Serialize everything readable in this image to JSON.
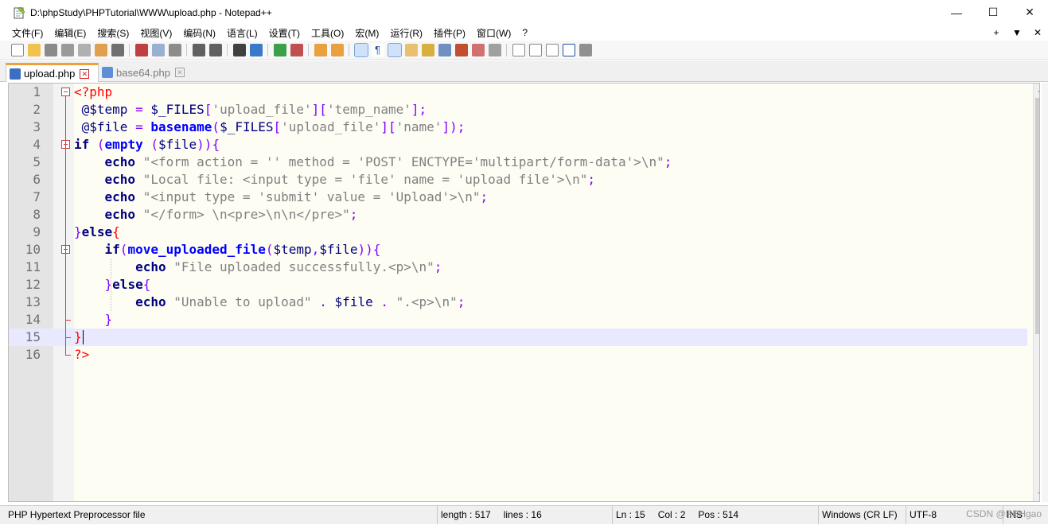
{
  "window": {
    "title": "D:\\phpStudy\\PHPTutorial\\WWW\\upload.php - Notepad++",
    "minimize": "—",
    "maximize": "☐",
    "close": "✕"
  },
  "menu": {
    "items": [
      "文件(F)",
      "编辑(E)",
      "搜索(S)",
      "视图(V)",
      "编码(N)",
      "语言(L)",
      "设置(T)",
      "工具(O)",
      "宏(M)",
      "运行(R)",
      "插件(P)",
      "窗口(W)",
      "?"
    ],
    "right_plus": "+",
    "right_down": "▼",
    "right_close": "✕"
  },
  "tabs": [
    {
      "label": "upload.php",
      "active": true
    },
    {
      "label": "base64.php",
      "active": false
    }
  ],
  "tab_close_glyph": "✕",
  "editor": {
    "line_numbers": [
      "1",
      "2",
      "3",
      "4",
      "5",
      "6",
      "7",
      "8",
      "9",
      "10",
      "11",
      "12",
      "13",
      "14",
      "15",
      "16"
    ],
    "current_line": 15
  },
  "status": {
    "filetype": "PHP Hypertext Preprocessor file",
    "length": "length : 517",
    "lines": "lines : 16",
    "ln": "Ln : 15",
    "col": "Col : 2",
    "pos": "Pos : 514",
    "eol": "Windows (CR LF)",
    "encoding": "UTF-8",
    "ins": "INS"
  },
  "watermark": "CSDN @RBHgao",
  "colors": {
    "keyword": "#00007f",
    "function": "#0000ff",
    "string": "#808080",
    "operator": "#8000ff",
    "php_tag": "#ff0000",
    "editor_bg": "#fefdf4",
    "current_line_bg": "#e8e8ff",
    "active_tab_accent": "#f0a035"
  },
  "icons": [
    "new-file-icon",
    "open-file-icon",
    "save-icon",
    "save-all-icon",
    "close-icon",
    "close-all-icon",
    "print-icon",
    "cut-icon",
    "copy-icon",
    "paste-icon",
    "undo-icon",
    "redo-icon",
    "find-icon",
    "replace-icon",
    "zoom-in-icon",
    "zoom-out-icon",
    "sync-v-icon",
    "sync-h-icon",
    "word-wrap-icon",
    "show-all-chars-icon",
    "indent-guide-icon",
    "udl-icon",
    "doc-map-icon",
    "function-list-icon",
    "folder-workspace-icon",
    "monitor-icon",
    "eye-icon",
    "record-macro-icon",
    "stop-macro-icon",
    "play-macro-icon",
    "run-macro-multiple-icon",
    "save-macro-icon"
  ]
}
